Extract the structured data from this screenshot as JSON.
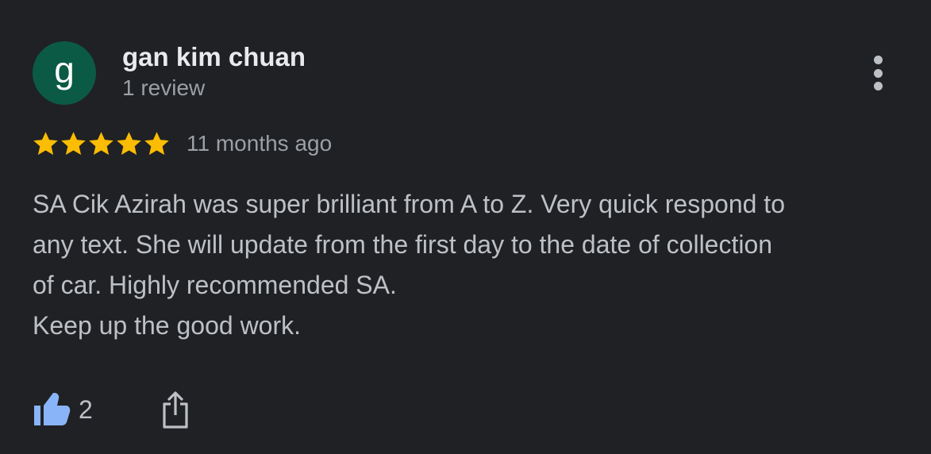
{
  "review": {
    "avatar_letter": "g",
    "avatar_color": "#0b5a45",
    "author_name": "gan kim chuan",
    "author_reviews": "1 review",
    "rating": 5,
    "rating_max": 5,
    "star_color": "#fbbc04",
    "date": "11 months ago",
    "text_lines": [
      "SA Cik Azirah was super brilliant from A to Z. Very quick respond to",
      "any text. She will update from the first day to the date of collection",
      "of car. Highly recommended SA.",
      "Keep up the good work."
    ],
    "likes": "2"
  },
  "icons": {
    "more": "more-vert-icon",
    "like": "thumb-up-icon",
    "share": "share-icon"
  },
  "colors": {
    "background": "#202124",
    "accent_blue": "#8ab4f8"
  }
}
